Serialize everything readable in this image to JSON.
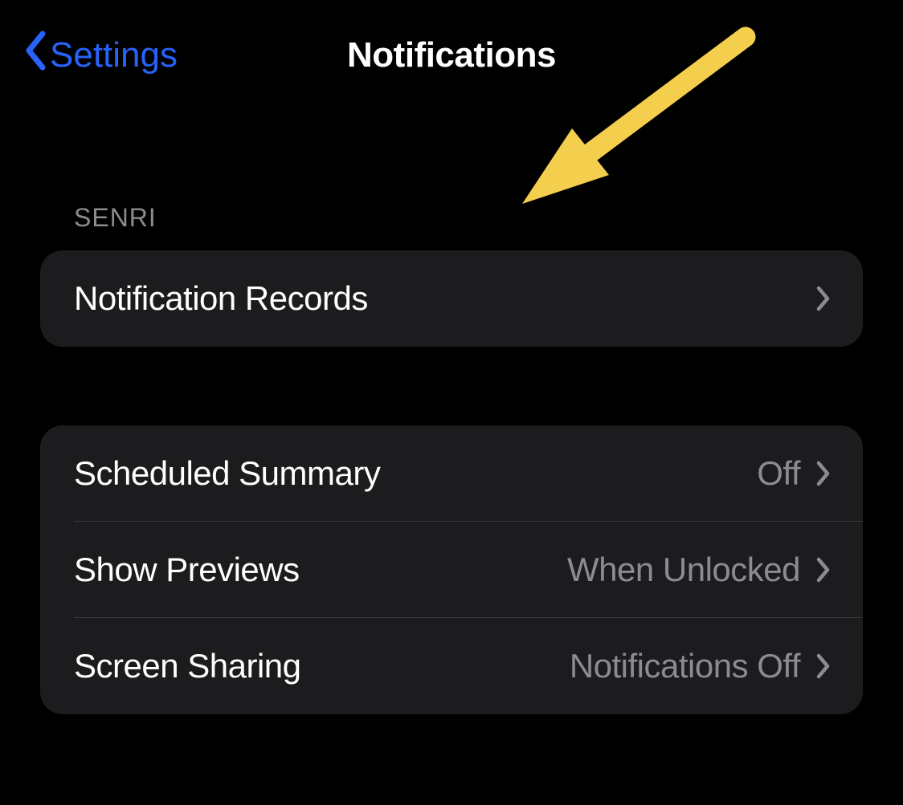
{
  "nav": {
    "back_label": "Settings",
    "title": "Notifications"
  },
  "sections": {
    "section1": {
      "header": "SENRI",
      "rows": [
        {
          "label": "Notification Records",
          "value": ""
        }
      ]
    },
    "section2": {
      "rows": [
        {
          "label": "Scheduled Summary",
          "value": "Off"
        },
        {
          "label": "Show Previews",
          "value": "When Unlocked"
        },
        {
          "label": "Screen Sharing",
          "value": "Notifications Off"
        }
      ]
    }
  },
  "annotation": {
    "arrow_color": "#f4cf4d"
  }
}
